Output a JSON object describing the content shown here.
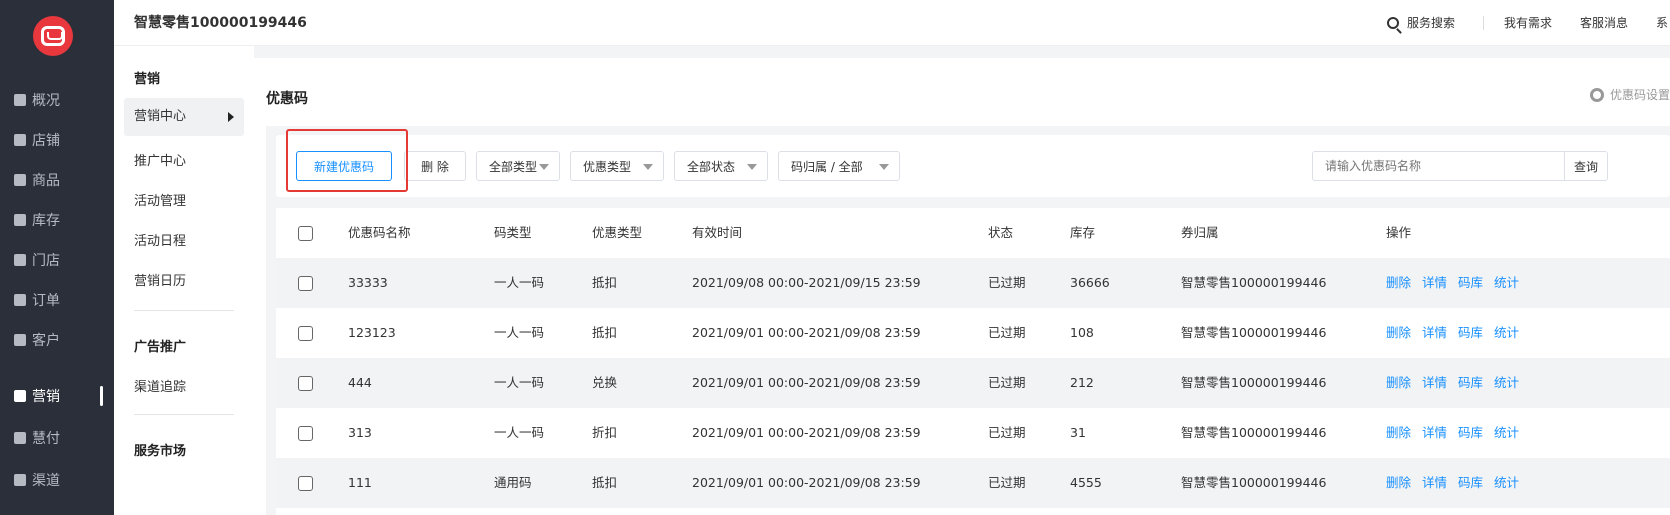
{
  "nav": {
    "items": [
      {
        "label": "概况",
        "icon": "list-icon"
      },
      {
        "label": "店铺",
        "icon": "store-icon"
      },
      {
        "label": "商品",
        "icon": "goods-icon"
      },
      {
        "label": "库存",
        "icon": "inventory-icon"
      },
      {
        "label": "门店",
        "icon": "shop-icon"
      },
      {
        "label": "订单",
        "icon": "order-icon"
      },
      {
        "label": "客户",
        "icon": "customer-icon"
      },
      {
        "label": "营销",
        "icon": "chart-icon"
      },
      {
        "label": "慧付",
        "icon": "pay-icon"
      },
      {
        "label": "渠道",
        "icon": "channel-icon"
      }
    ],
    "active_index": 7
  },
  "subnav": {
    "groups": [
      "营销",
      "广告推广",
      "服务市场"
    ],
    "items": [
      "营销中心",
      "推广中心",
      "活动管理",
      "活动日程",
      "营销日历",
      "渠道追踪"
    ],
    "selected": "营销中心"
  },
  "header": {
    "brand": "智慧零售100000199446",
    "search": "服务搜索",
    "need": "我有需求",
    "service": "客服消息",
    "system": "系"
  },
  "page": {
    "title": "优惠码",
    "settings": "优惠码设置"
  },
  "toolbar": {
    "new_label": "新建优惠码",
    "delete_label": "删 除",
    "filters": [
      "全部类型",
      "优惠类型",
      "全部状态",
      "码归属 / 全部"
    ],
    "search_placeholder": "请输入优惠码名称",
    "query_label": "查询"
  },
  "table": {
    "headers": [
      "优惠码名称",
      "码类型",
      "优惠类型",
      "有效时间",
      "状态",
      "库存",
      "券归属",
      "操作"
    ],
    "ops": [
      "删除",
      "详情",
      "码库",
      "统计"
    ],
    "rows": [
      {
        "name": "33333",
        "code_type": "一人一码",
        "discount_type": "抵扣",
        "time": "2021/09/08 00:00-2021/09/15 23:59",
        "status": "已过期",
        "stock": "36666",
        "owner": "智慧零售100000199446"
      },
      {
        "name": "123123",
        "code_type": "一人一码",
        "discount_type": "抵扣",
        "time": "2021/09/01 00:00-2021/09/08 23:59",
        "status": "已过期",
        "stock": "108",
        "owner": "智慧零售100000199446"
      },
      {
        "name": "444",
        "code_type": "一人一码",
        "discount_type": "兑换",
        "time": "2021/09/01 00:00-2021/09/08 23:59",
        "status": "已过期",
        "stock": "212",
        "owner": "智慧零售100000199446"
      },
      {
        "name": "313",
        "code_type": "一人一码",
        "discount_type": "折扣",
        "time": "2021/09/01 00:00-2021/09/08 23:59",
        "status": "已过期",
        "stock": "31",
        "owner": "智慧零售100000199446"
      },
      {
        "name": "111",
        "code_type": "通用码",
        "discount_type": "抵扣",
        "time": "2021/09/01 00:00-2021/09/08 23:59",
        "status": "已过期",
        "stock": "4555",
        "owner": "智慧零售100000199446"
      }
    ]
  },
  "colors": {
    "nav_bg": "#2b2f3a",
    "accent": "#1890ff",
    "highlight": "#e53935",
    "logo": "#e8383d"
  }
}
